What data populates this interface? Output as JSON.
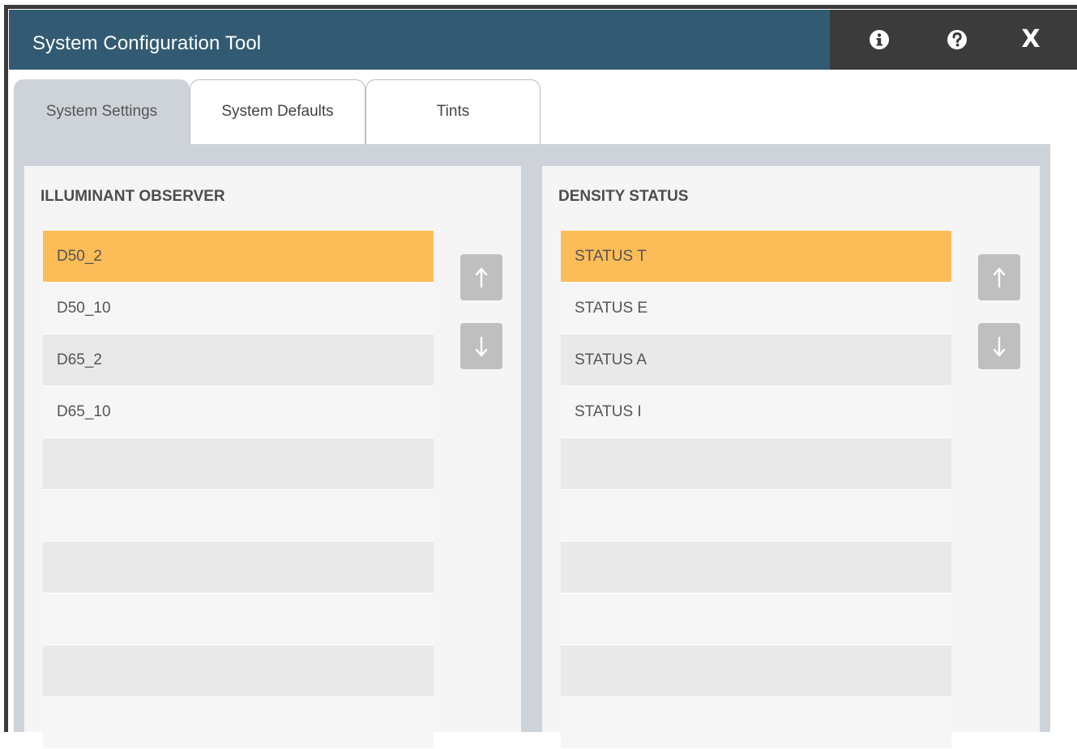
{
  "window": {
    "title": "System Configuration Tool",
    "actions": {
      "close_label": "X"
    }
  },
  "tabs": [
    {
      "label": "System Settings",
      "active": true
    },
    {
      "label": "System Defaults",
      "active": false
    },
    {
      "label": "Tints",
      "active": false
    }
  ],
  "illuminant_panel": {
    "title": "ILLUMINANT OBSERVER",
    "items": [
      "D50_2",
      "D50_10",
      "D65_2",
      "D65_10"
    ],
    "selected": "D50_2"
  },
  "density_panel": {
    "title": "DENSITY STATUS",
    "items": [
      "STATUS T",
      "STATUS E",
      "STATUS A",
      "STATUS I"
    ],
    "selected": "STATUS T"
  },
  "colors": {
    "title_bar": "#325b73",
    "title_actions_bg": "#3b3b3b",
    "selected_row": "#fcbc57",
    "content_bg": "#cdd3d8",
    "arrow_button": "#bfbfbf"
  },
  "icons": {
    "info": "info-icon",
    "help": "help-icon",
    "move_up": "arrow-up-icon",
    "move_down": "arrow-down-icon"
  }
}
